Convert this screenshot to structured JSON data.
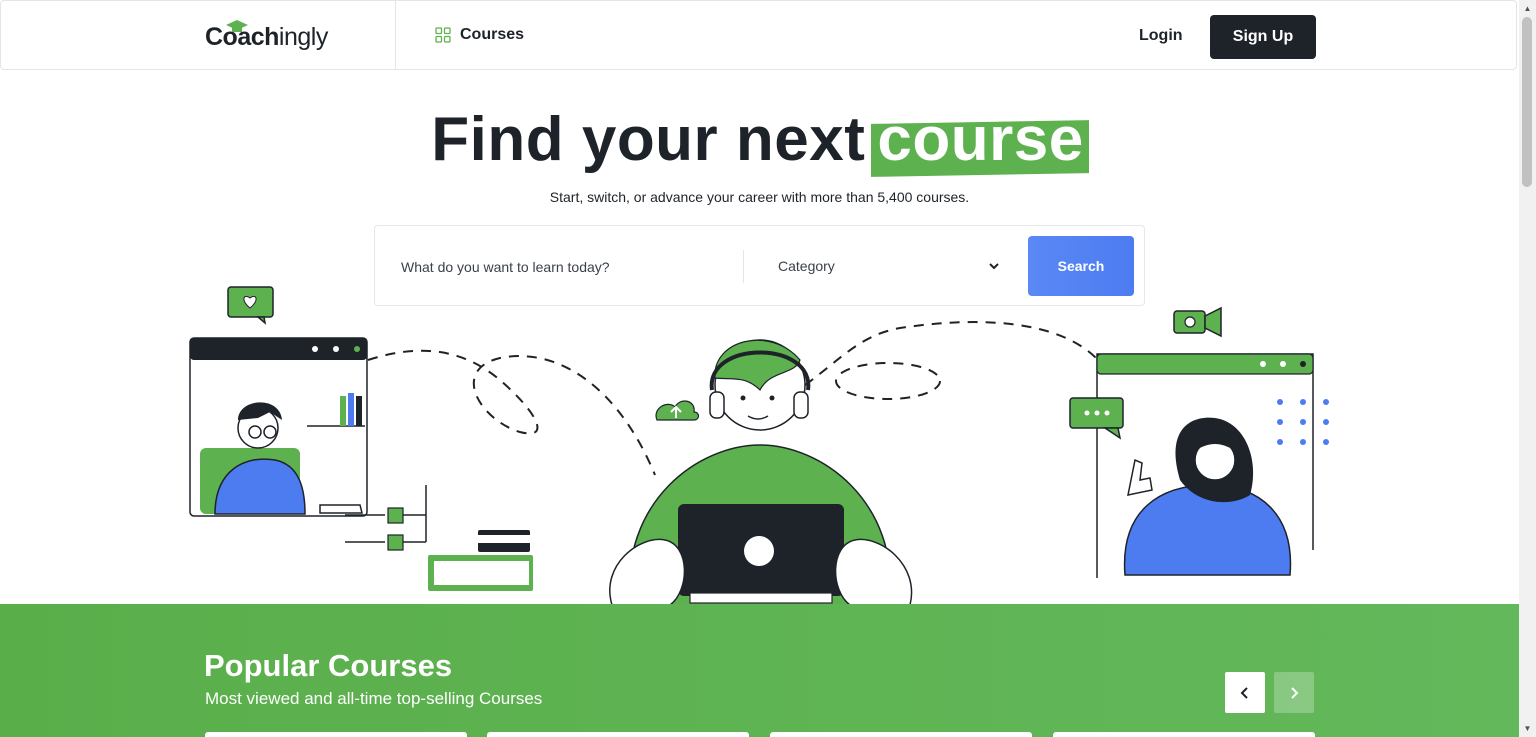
{
  "header": {
    "logo_bold": "Coach",
    "logo_light": "ingly",
    "courses_label": "Courses",
    "login_label": "Login",
    "signup_label": "Sign Up"
  },
  "hero": {
    "title": "Find your next",
    "title_highlight": "course",
    "subtitle": "Start, switch, or advance your career with more than 5,400 courses."
  },
  "search": {
    "placeholder": "What do you want to learn today?",
    "category_label": "Category",
    "button_label": "Search"
  },
  "popular": {
    "title": "Popular Courses",
    "subtitle": "Most viewed and all-time top-selling Courses"
  },
  "colors": {
    "brand_green": "#5eb14f",
    "dark": "#1e232a",
    "accent_blue": "#4d7cf1"
  },
  "icons": {
    "courses": "grid-icon",
    "category": "chevron-down-icon",
    "prev": "chevron-left-icon",
    "next": "chevron-right-icon"
  }
}
